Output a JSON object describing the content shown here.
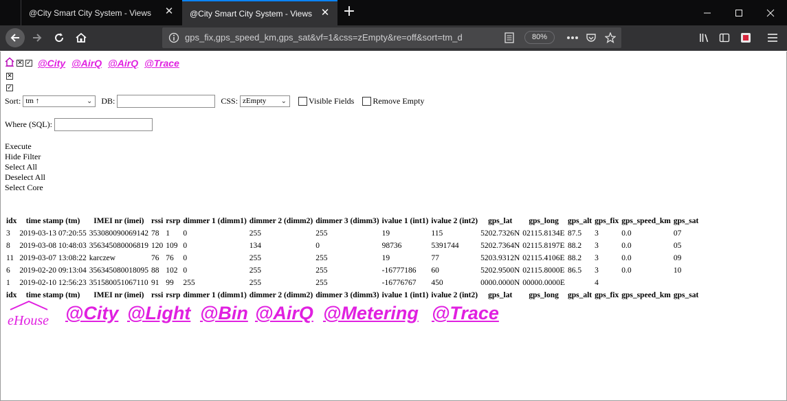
{
  "browser": {
    "tabs": [
      {
        "title": "@City Smart City System - Views",
        "active": false
      },
      {
        "title": "@City Smart City System - Views",
        "active": true
      }
    ],
    "new_tab": "+",
    "url_visible": "gps_fix,gps_speed_km,gps_sat&vf=1&css=zEmpty&re=off&sort=tm_d",
    "zoom": "80%",
    "accent": "#0a84ff"
  },
  "page": {
    "top_links": [
      "@City",
      "@AirQ",
      "@AirQ",
      "@Trace"
    ],
    "brand_color": "#e020e0",
    "filter": {
      "sort_label": "Sort:",
      "sort_value": "tm ↑",
      "db_label": "DB:",
      "db_value": "",
      "css_label": "CSS:",
      "css_value": "zEmpty",
      "visible_fields_label": "Visible Fields",
      "remove_empty_label": "Remove Empty",
      "where_label": "Where (SQL):",
      "where_value": ""
    },
    "actions": [
      "Execute",
      "Hide Filter",
      "Select All",
      "Deselect All",
      "Select Core"
    ],
    "table": {
      "columns": [
        "idx",
        "time stamp (tm)",
        "IMEI nr (imei)",
        "rssi",
        "rsrp",
        "dimmer 1 (dimm1)",
        "dimmer 2 (dimm2)",
        "dimmer 3 (dimm3)",
        "ivalue 1 (int1)",
        "ivalue 2 (int2)",
        "gps_lat",
        "gps_long",
        "gps_alt",
        "gps_fix",
        "gps_speed_km",
        "gps_sat"
      ],
      "rows": [
        [
          "3",
          "2019-03-13 07:20:55",
          "353080090069142",
          "78",
          "1",
          "0",
          "255",
          "255",
          "19",
          "115",
          "5202.7326N",
          "02115.8134E",
          "87.5",
          "3",
          "0.0",
          "07"
        ],
        [
          "8",
          "2019-03-08 10:48:03",
          "356345080006819",
          "120",
          "109",
          "0",
          "134",
          "0",
          "98736",
          "5391744",
          "5202.7364N",
          "02115.8197E",
          "88.2",
          "3",
          "0.0",
          "05"
        ],
        [
          "11",
          "2019-03-07 13:08:22",
          "karczew",
          "76",
          "76",
          "0",
          "255",
          "255",
          "19",
          "77",
          "5203.9312N",
          "02115.4106E",
          "88.2",
          "3",
          "0.0",
          "09"
        ],
        [
          "6",
          "2019-02-20 09:13:04",
          "356345080018095",
          "88",
          "102",
          "0",
          "255",
          "255",
          "-16777186",
          "60",
          "5202.9500N",
          "02115.8000E",
          "86.5",
          "3",
          "0.0",
          "10"
        ],
        [
          "1",
          "2019-02-10 12:56:23",
          "351580051067110",
          "91",
          "99",
          "255",
          "255",
          "255",
          "-16776767",
          "450",
          "0000.0000N",
          "00000.0000E",
          "",
          "4",
          "",
          ""
        ]
      ]
    },
    "footer_logos": [
      "eHouse",
      "@City",
      "@Light",
      "@Bin",
      "@AirQ",
      "@Metering",
      "@Trace"
    ]
  }
}
